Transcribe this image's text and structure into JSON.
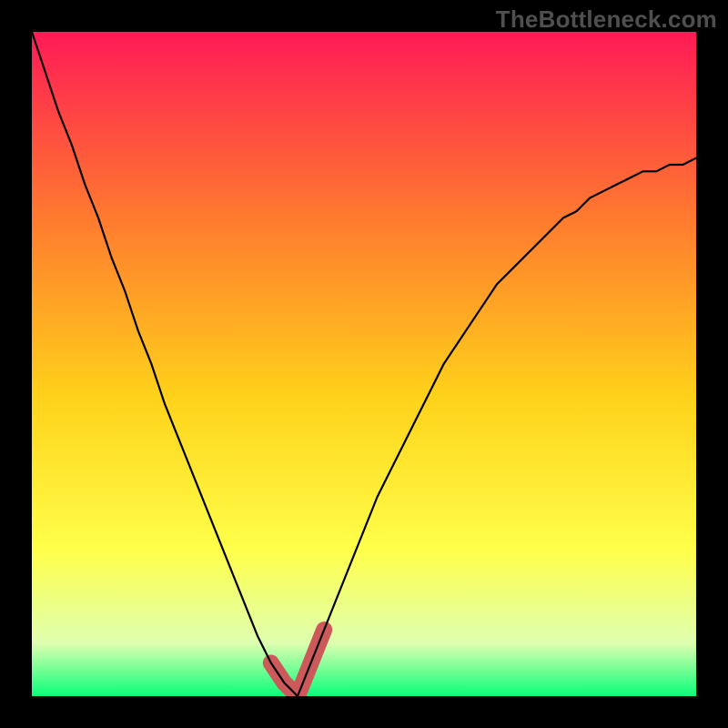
{
  "watermark": "TheBottleneck.com",
  "colors": {
    "gradient_top": "#ff1a55",
    "gradient_mid1": "#ff7a2f",
    "gradient_mid2": "#ffd21a",
    "gradient_mid3": "#ffff4a",
    "gradient_mid4": "#dfffb0",
    "gradient_bottom": "#0aff7a",
    "curve": "#000000",
    "highlight": "#cc5a5a",
    "frame": "#000000"
  },
  "chart_data": {
    "type": "line",
    "title": "",
    "xlabel": "",
    "ylabel": "",
    "xlim": [
      0,
      100
    ],
    "ylim": [
      0,
      100
    ],
    "x": [
      0,
      2,
      4,
      6,
      8,
      10,
      12,
      14,
      16,
      18,
      20,
      22,
      24,
      26,
      28,
      30,
      32,
      34,
      36,
      38,
      40,
      42,
      44,
      46,
      48,
      50,
      52,
      54,
      56,
      58,
      60,
      62,
      64,
      66,
      68,
      70,
      72,
      74,
      76,
      78,
      80,
      82,
      84,
      86,
      88,
      90,
      92,
      94,
      96,
      98,
      100
    ],
    "series": [
      {
        "name": "bottleneck-curve",
        "values": [
          100,
          94,
          88,
          83,
          77,
          72,
          66,
          61,
          55,
          50,
          44,
          39,
          34,
          29,
          24,
          19,
          14,
          9,
          5,
          2,
          0,
          5,
          10,
          15,
          20,
          25,
          30,
          34,
          38,
          42,
          46,
          50,
          53,
          56,
          59,
          62,
          64,
          66,
          68,
          70,
          72,
          73,
          75,
          76,
          77,
          78,
          79,
          79,
          80,
          80,
          81
        ]
      }
    ],
    "highlight": {
      "name": "optimal-band",
      "x_range": [
        36,
        46
      ],
      "y_max": 12
    },
    "annotations": []
  }
}
